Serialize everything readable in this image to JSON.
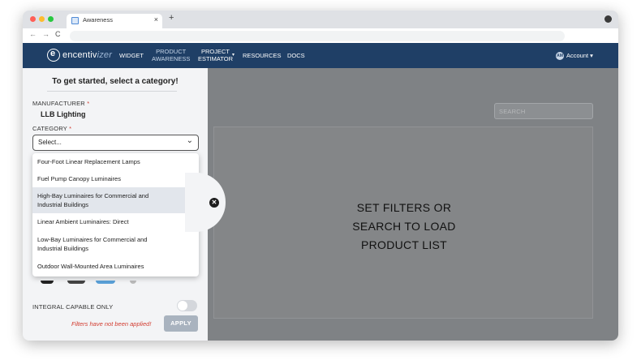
{
  "browser": {
    "tab_title": "Awareness",
    "tab_close": "×",
    "new_tab": "+",
    "nav_back": "←",
    "nav_forward": "→",
    "nav_reload": "C",
    "traffic_colors": [
      "#ff5f57",
      "#febc2e",
      "#28c840"
    ]
  },
  "appnav": {
    "logo_prefix": "encentiv",
    "logo_suffix": "izer",
    "items": [
      {
        "label": "WIDGET"
      },
      {
        "label_line1": "PRODUCT",
        "label_line2": "AWARENESS"
      },
      {
        "label_line1": "PROJECT",
        "label_line2": "ESTIMATOR"
      },
      {
        "label": "RESOURCES"
      },
      {
        "label": "DOCS"
      }
    ],
    "estimator_caret": "▾",
    "account_initials": "AM",
    "account_label": "Account ▾"
  },
  "sidebar": {
    "title": "To get started, select a category!",
    "manufacturer_label": "MANUFACTURER",
    "manufacturer_value": "LLB Lighting",
    "category_label": "CATEGORY",
    "required_mark": "*",
    "category_select_value": "Select...",
    "category_options": [
      {
        "label": "Four-Foot Linear Replacement Lamps"
      },
      {
        "label": "Fuel Pump Canopy Luminaires"
      },
      {
        "label_line1": "High-Bay Luminaires for Commercial and",
        "label_line2": "Industrial Buildings",
        "highlighted": true
      },
      {
        "label": "Linear Ambient Luminaires: Direct"
      },
      {
        "label_line1": "Low-Bay Luminaires for Commercial and",
        "label_line2": "Industrial Buildings"
      },
      {
        "label": "Outdoor Wall-Mounted Area Luminaires"
      }
    ],
    "integral_label": "INTEGRAL CAPABLE ONLY",
    "integral_enabled": false,
    "filters_note": "Filters have not been applied!",
    "apply_label": "APPLY"
  },
  "main": {
    "search_placeholder": "SEARCH",
    "message_line1": "SET FILTERS OR",
    "message_line2": "SEARCH TO LOAD",
    "message_line3": "PRODUCT LIST"
  },
  "colors": {
    "nav_bg": "#1f3f66",
    "required": "#d23b2f",
    "apply_disabled": "#a9b3bf",
    "overlay": "#7f8285"
  }
}
